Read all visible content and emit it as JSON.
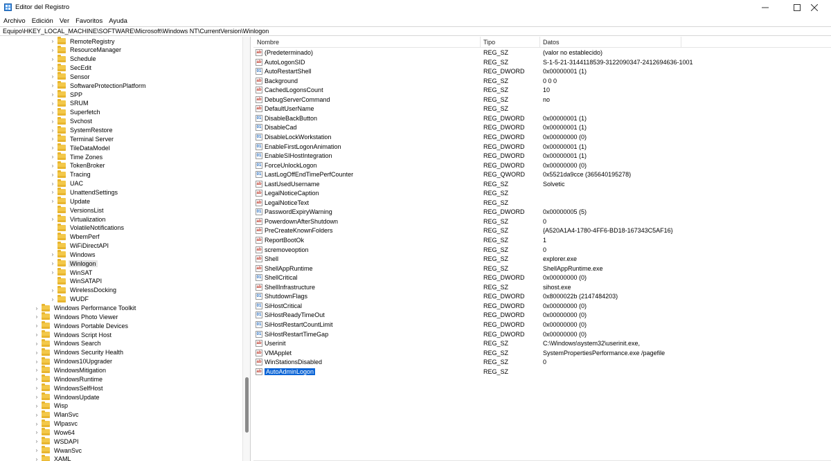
{
  "window": {
    "title": "Editor del Registro"
  },
  "menu": [
    "Archivo",
    "Edición",
    "Ver",
    "Favoritos",
    "Ayuda"
  ],
  "address": "Equipo\\HKEY_LOCAL_MACHINE\\SOFTWARE\\Microsoft\\Windows NT\\CurrentVersion\\Winlogon",
  "tree": [
    {
      "label": "RemoteRegistry",
      "level": 2
    },
    {
      "label": "ResourceManager",
      "level": 2
    },
    {
      "label": "Schedule",
      "level": 2
    },
    {
      "label": "SecEdit",
      "level": 2
    },
    {
      "label": "Sensor",
      "level": 2
    },
    {
      "label": "SoftwareProtectionPlatform",
      "level": 2
    },
    {
      "label": "SPP",
      "level": 2
    },
    {
      "label": "SRUM",
      "level": 2
    },
    {
      "label": "Superfetch",
      "level": 2
    },
    {
      "label": "Svchost",
      "level": 2
    },
    {
      "label": "SystemRestore",
      "level": 2
    },
    {
      "label": "Terminal Server",
      "level": 2
    },
    {
      "label": "TileDataModel",
      "level": 2
    },
    {
      "label": "Time Zones",
      "level": 2
    },
    {
      "label": "TokenBroker",
      "level": 2
    },
    {
      "label": "Tracing",
      "level": 2
    },
    {
      "label": "UAC",
      "level": 2
    },
    {
      "label": "UnattendSettings",
      "level": 2
    },
    {
      "label": "Update",
      "level": 2
    },
    {
      "label": "VersionsList",
      "level": 2,
      "leaf": true
    },
    {
      "label": "Virtualization",
      "level": 2
    },
    {
      "label": "VolatileNotifications",
      "level": 2,
      "leaf": true
    },
    {
      "label": "WbemPerf",
      "level": 2,
      "leaf": true
    },
    {
      "label": "WiFiDirectAPI",
      "level": 2,
      "leaf": true
    },
    {
      "label": "Windows",
      "level": 2
    },
    {
      "label": "Winlogon",
      "level": 2,
      "selected": true
    },
    {
      "label": "WinSAT",
      "level": 2
    },
    {
      "label": "WinSATAPI",
      "level": 2,
      "leaf": true
    },
    {
      "label": "WirelessDocking",
      "level": 2
    },
    {
      "label": "WUDF",
      "level": 2
    },
    {
      "label": "Windows Performance Toolkit",
      "level": 1
    },
    {
      "label": "Windows Photo Viewer",
      "level": 1
    },
    {
      "label": "Windows Portable Devices",
      "level": 1
    },
    {
      "label": "Windows Script Host",
      "level": 1
    },
    {
      "label": "Windows Search",
      "level": 1
    },
    {
      "label": "Windows Security Health",
      "level": 1
    },
    {
      "label": "Windows10Upgrader",
      "level": 1
    },
    {
      "label": "WindowsMitigation",
      "level": 1
    },
    {
      "label": "WindowsRuntime",
      "level": 1
    },
    {
      "label": "WindowsSelfHost",
      "level": 1
    },
    {
      "label": "WindowsUpdate",
      "level": 1
    },
    {
      "label": "Wisp",
      "level": 1
    },
    {
      "label": "WlanSvc",
      "level": 1
    },
    {
      "label": "Wlpasvc",
      "level": 1
    },
    {
      "label": "Wow64",
      "level": 1
    },
    {
      "label": "WSDAPI",
      "level": 1
    },
    {
      "label": "WwanSvc",
      "level": 1
    },
    {
      "label": "XAML",
      "level": 1
    }
  ],
  "columns": {
    "name": "Nombre",
    "type": "Tipo",
    "data": "Datos"
  },
  "values": [
    {
      "name": "(Predeterminado)",
      "type": "REG_SZ",
      "data": "(valor no establecido)",
      "icon": "string"
    },
    {
      "name": "AutoLogonSID",
      "type": "REG_SZ",
      "data": "S-1-5-21-3144118539-3122090347-2412694636-1001",
      "icon": "string"
    },
    {
      "name": "AutoRestartShell",
      "type": "REG_DWORD",
      "data": "0x00000001 (1)",
      "icon": "binary"
    },
    {
      "name": "Background",
      "type": "REG_SZ",
      "data": "0 0 0",
      "icon": "string"
    },
    {
      "name": "CachedLogonsCount",
      "type": "REG_SZ",
      "data": "10",
      "icon": "string"
    },
    {
      "name": "DebugServerCommand",
      "type": "REG_SZ",
      "data": "no",
      "icon": "string"
    },
    {
      "name": "DefaultUserName",
      "type": "REG_SZ",
      "data": "",
      "icon": "string"
    },
    {
      "name": "DisableBackButton",
      "type": "REG_DWORD",
      "data": "0x00000001 (1)",
      "icon": "binary"
    },
    {
      "name": "DisableCad",
      "type": "REG_DWORD",
      "data": "0x00000001 (1)",
      "icon": "binary"
    },
    {
      "name": "DisableLockWorkstation",
      "type": "REG_DWORD",
      "data": "0x00000000 (0)",
      "icon": "binary"
    },
    {
      "name": "EnableFirstLogonAnimation",
      "type": "REG_DWORD",
      "data": "0x00000001 (1)",
      "icon": "binary"
    },
    {
      "name": "EnableSIHostIntegration",
      "type": "REG_DWORD",
      "data": "0x00000001 (1)",
      "icon": "binary"
    },
    {
      "name": "ForceUnlockLogon",
      "type": "REG_DWORD",
      "data": "0x00000000 (0)",
      "icon": "binary"
    },
    {
      "name": "LastLogOffEndTimePerfCounter",
      "type": "REG_QWORD",
      "data": "0x5521da9cce (365640195278)",
      "icon": "binary"
    },
    {
      "name": "LastUsedUsername",
      "type": "REG_SZ",
      "data": "Solvetic",
      "icon": "string"
    },
    {
      "name": "LegalNoticeCaption",
      "type": "REG_SZ",
      "data": "",
      "icon": "string"
    },
    {
      "name": "LegalNoticeText",
      "type": "REG_SZ",
      "data": "",
      "icon": "string"
    },
    {
      "name": "PasswordExpiryWarning",
      "type": "REG_DWORD",
      "data": "0x00000005 (5)",
      "icon": "binary"
    },
    {
      "name": "PowerdownAfterShutdown",
      "type": "REG_SZ",
      "data": "0",
      "icon": "string"
    },
    {
      "name": "PreCreateKnownFolders",
      "type": "REG_SZ",
      "data": "{A520A1A4-1780-4FF6-BD18-167343C5AF16}",
      "icon": "string"
    },
    {
      "name": "ReportBootOk",
      "type": "REG_SZ",
      "data": "1",
      "icon": "string"
    },
    {
      "name": "scremoveoption",
      "type": "REG_SZ",
      "data": "0",
      "icon": "string"
    },
    {
      "name": "Shell",
      "type": "REG_SZ",
      "data": "explorer.exe",
      "icon": "string"
    },
    {
      "name": "ShellAppRuntime",
      "type": "REG_SZ",
      "data": "ShellAppRuntime.exe",
      "icon": "string"
    },
    {
      "name": "ShellCritical",
      "type": "REG_DWORD",
      "data": "0x00000000 (0)",
      "icon": "binary"
    },
    {
      "name": "ShellInfrastructure",
      "type": "REG_SZ",
      "data": "sihost.exe",
      "icon": "string"
    },
    {
      "name": "ShutdownFlags",
      "type": "REG_DWORD",
      "data": "0x8000022b (2147484203)",
      "icon": "binary"
    },
    {
      "name": "SiHostCritical",
      "type": "REG_DWORD",
      "data": "0x00000000 (0)",
      "icon": "binary"
    },
    {
      "name": "SiHostReadyTimeOut",
      "type": "REG_DWORD",
      "data": "0x00000000 (0)",
      "icon": "binary"
    },
    {
      "name": "SiHostRestartCountLimit",
      "type": "REG_DWORD",
      "data": "0x00000000 (0)",
      "icon": "binary"
    },
    {
      "name": "SiHostRestartTimeGap",
      "type": "REG_DWORD",
      "data": "0x00000000 (0)",
      "icon": "binary"
    },
    {
      "name": "Userinit",
      "type": "REG_SZ",
      "data": "C:\\Windows\\system32\\userinit.exe,",
      "icon": "string"
    },
    {
      "name": "VMApplet",
      "type": "REG_SZ",
      "data": "SystemPropertiesPerformance.exe /pagefile",
      "icon": "string"
    },
    {
      "name": "WinStationsDisabled",
      "type": "REG_SZ",
      "data": "0",
      "icon": "string"
    },
    {
      "name": "AutoAdminLogon",
      "type": "REG_SZ",
      "data": "",
      "icon": "string",
      "selected": true
    }
  ]
}
